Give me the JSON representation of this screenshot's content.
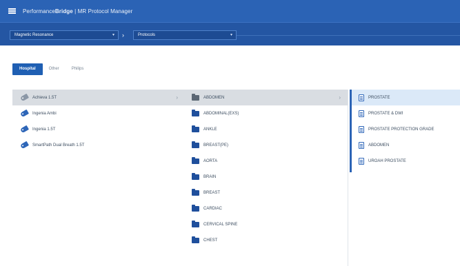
{
  "header": {
    "brand": "Performance",
    "brand_bold": "Bridge",
    "subtitle": " | MR Protocol Manager"
  },
  "navbar": {
    "modality": "Magnetic Resonance",
    "separator": "›",
    "location": "Protocols"
  },
  "tabs": [
    {
      "label": "Hospital",
      "active": true
    },
    {
      "label": "Other",
      "active": false
    },
    {
      "label": "Philips",
      "active": false
    }
  ],
  "column1": [
    {
      "label": "Achieva 1.5T",
      "selected": true
    },
    {
      "label": "Ingenia Ambi",
      "selected": false
    },
    {
      "label": "Ingenia 1.5T",
      "selected": false
    },
    {
      "label": "SmartPath Dual Breath 1.5T",
      "selected": false
    }
  ],
  "column2": [
    {
      "label": "ABDOMEN",
      "selected": true
    },
    {
      "label": "ABDOMINAL(EXS)",
      "selected": false
    },
    {
      "label": "ANKLE",
      "selected": false
    },
    {
      "label": "BREAST(PE)",
      "selected": false
    },
    {
      "label": "AORTA",
      "selected": false
    },
    {
      "label": "BRAIN",
      "selected": false
    },
    {
      "label": "BREAST",
      "selected": false
    },
    {
      "label": "CARDIAC",
      "selected": false
    },
    {
      "label": "CERVICAL SPINE",
      "selected": false
    },
    {
      "label": "CHEST",
      "selected": false
    }
  ],
  "column3": [
    {
      "label": "PROSTATE",
      "selected": true
    },
    {
      "label": "PROSTATE & DWI",
      "selected": false
    },
    {
      "label": "PROSTATE PROTECTION GRADE",
      "selected": false
    },
    {
      "label": "ABDOMEN",
      "selected": false
    },
    {
      "label": "UROAH PROSTATE",
      "selected": false
    }
  ],
  "colors": {
    "topbar": "#2b63b5",
    "navbar": "#2456a3",
    "accent": "#1f5fb3",
    "selected_grey": "#d9dde2",
    "selected_blue": "#dbe9f8"
  }
}
